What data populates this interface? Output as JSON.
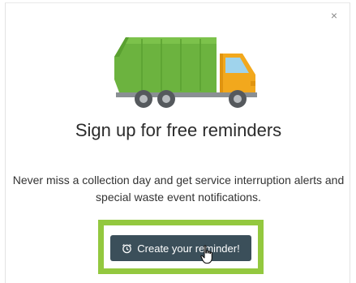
{
  "modal": {
    "close_glyph": "×",
    "title": "Sign up for free reminders",
    "description": "Never miss a collection day and get service interruption alerts and special waste event notifications.",
    "cta_label": "Create your reminder!",
    "icons": {
      "close": "close-icon",
      "truck": "garbage-truck-illustration",
      "alarm": "alarm-clock-icon",
      "cursor": "hand-pointer-cursor"
    },
    "colors": {
      "truck_body": "#6cb33f",
      "truck_cab": "#f2a81d",
      "button_bg": "#3b4f5a",
      "highlight": "#93c83f"
    }
  }
}
